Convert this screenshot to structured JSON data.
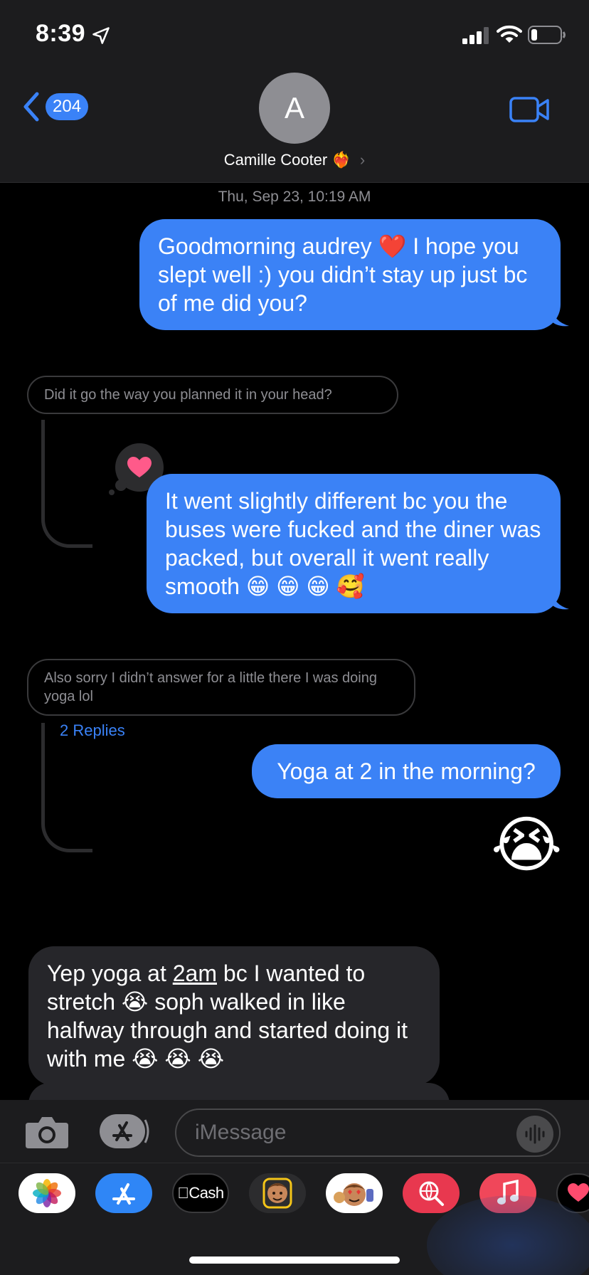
{
  "status_bar": {
    "time": "8:39",
    "location_icon": "location-arrow-icon",
    "signal_icon": "cellular-signal-icon",
    "wifi_icon": "wifi-icon",
    "battery_icon": "battery-icon"
  },
  "header": {
    "back_count": "204",
    "avatar_initial": "A",
    "contact_name": "Camille Cooter",
    "contact_emoji": "❤️‍🔥",
    "chevron": "›",
    "video_icon": "video-camera-icon"
  },
  "conversation": {
    "timestamp": "Thu, Sep 23, 10:19 AM",
    "msg1": "Goodmorning audrey ❤️ I hope you slept well :) you didn’t stay up just bc of me did you?",
    "reply_quote1": "Did it go the way you planned it in your head?",
    "tapback_icon": "heart-icon",
    "msg2": "It went slightly different bc you the buses were fucked and the diner was packed, but overall it went really smooth 😁 😁 😁 🥰",
    "reply_quote2": "Also sorry I didn’t answer for a little there I was doing yoga lol",
    "replies_link": "2 Replies",
    "msg3": "Yoga at 2 in the morning?",
    "msg4_emoji": "😭",
    "msg5_part1": "Yep yoga at ",
    "msg5_link": "2am",
    "msg5_part2": " bc I wanted to stretch 😭 soph walked in like halfway through and started doing it with me 😭 😭 😭"
  },
  "input_bar": {
    "placeholder": "iMessage",
    "camera_icon": "camera-icon",
    "apps_icon": "app-store-icon",
    "audio_icon": "waveform-icon"
  },
  "app_drawer": {
    "apps": [
      {
        "name": "photos-app-icon",
        "label": ""
      },
      {
        "name": "app-store-app-icon",
        "label": ""
      },
      {
        "name": "apple-cash-app-icon",
        "label": "Cash"
      },
      {
        "name": "memoji-app-icon",
        "label": ""
      },
      {
        "name": "memoji-stickers-app-icon",
        "label": ""
      },
      {
        "name": "web-images-app-icon",
        "label": ""
      },
      {
        "name": "music-app-icon",
        "label": ""
      },
      {
        "name": "digital-touch-app-icon",
        "label": ""
      }
    ]
  },
  "colors": {
    "accent": "#3b82f6",
    "incoming_bubble": "#26262a",
    "header_bg": "#1c1c1e"
  }
}
